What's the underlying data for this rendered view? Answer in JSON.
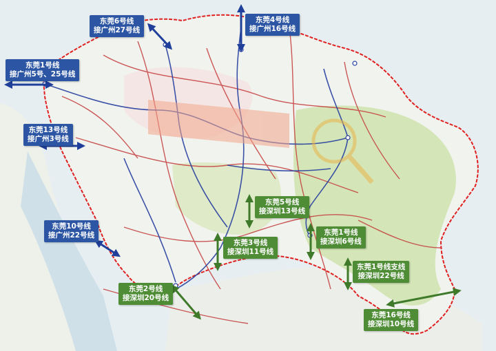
{
  "map": {
    "colors": {
      "boundary": "#e02020",
      "water": "#dce9ee",
      "land": "#f1f3ee",
      "green_land": "#c9dfa6",
      "blue_label": "#2c56a3",
      "green_label": "#4e8c35",
      "metro_line": "#2840a0",
      "rail_line": "#c43c3c"
    }
  },
  "labels": {
    "l6": {
      "line1": "东莞6号线",
      "line2": "接广州27号线"
    },
    "l4": {
      "line1": "东莞4号线",
      "line2": "接广州16号线"
    },
    "l1": {
      "line1": "东莞1号线",
      "line2": "接广州5号、25号线"
    },
    "l13": {
      "line1": "东莞13号线",
      "line2": "接广州3号线"
    },
    "l10": {
      "line1": "东莞10号线",
      "line2": "接广州22号线"
    },
    "l5": {
      "line1": "东莞5号线",
      "line2": "接深圳13号线"
    },
    "l3": {
      "line1": "东莞3号线",
      "line2": "接深圳11号线"
    },
    "l1s": {
      "line1": "东莞1号线",
      "line2": "接深圳6号线"
    },
    "l1b": {
      "line1": "东莞1号线支线",
      "line2": "接深圳22号线"
    },
    "l2": {
      "line1": "东莞2号线",
      "line2": "接深圳20号线"
    },
    "l16": {
      "line1": "东莞16号线",
      "line2": "接深圳10号线"
    }
  }
}
